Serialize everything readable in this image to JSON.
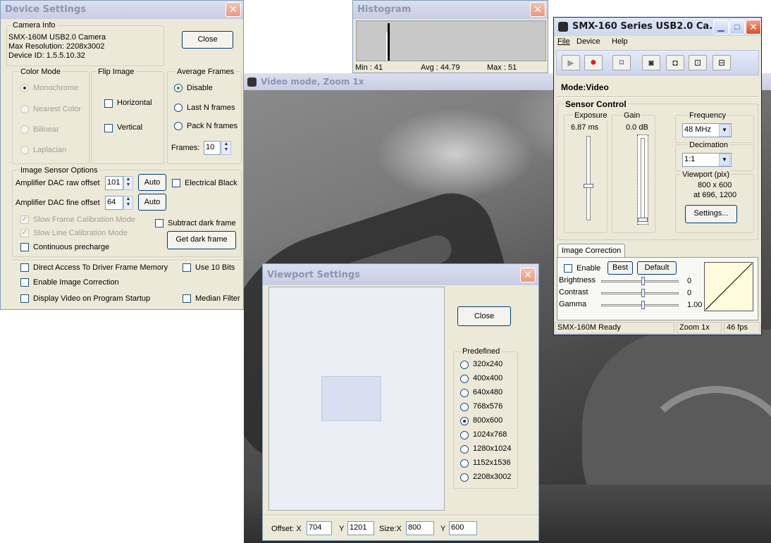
{
  "device_settings": {
    "title": "Device Settings",
    "camera_info": {
      "legend": "Camera Info",
      "model": "SMX-160M USB2.0 Camera",
      "max_resolution": "Max Resolution: 2208x3002",
      "device_id": "Device ID: 1.5.5.10.32"
    },
    "close_label": "Close",
    "color_mode": {
      "legend": "Color Mode",
      "options": [
        "Monochrome",
        "Nearest Color",
        "Bilinear",
        "Laplacian"
      ],
      "selected": "Monochrome"
    },
    "flip_image": {
      "legend": "Flip Image",
      "horizontal": "Horizontal",
      "vertical": "Vertical"
    },
    "average_frames": {
      "legend": "Average Frames",
      "options": [
        "Disable",
        "Last N frames",
        "Pack N frames"
      ],
      "selected": "Disable",
      "frames_label": "Frames:",
      "frames_value": "10"
    },
    "sensor_options": {
      "legend": "Image Sensor Options",
      "raw_offset_label": "Amplifier DAC raw offset",
      "raw_offset_value": "101",
      "fine_offset_label": "Amplifier DAC fine offset",
      "fine_offset_value": "64",
      "auto_label": "Auto",
      "electrical_black": "Electrical Black",
      "slow_frame_cal": "Slow Frame Calibration Mode",
      "slow_line_cal": "Slow Line Calibration Mode",
      "subtract_dark": "Subtract dark frame",
      "continuous_precharge": "Continuous precharge",
      "get_dark_frame": "Get dark frame"
    },
    "direct_access": "Direct Access To Driver Frame Memory",
    "use_10_bits": "Use 10 Bits",
    "enable_image_correction": "Enable Image Correction",
    "display_video_startup": "Display Video on Program Startup",
    "median_filter": "Median Filter"
  },
  "histogram": {
    "title": "Histogram",
    "min": "Min : 41",
    "avg": "Avg : 44.79",
    "max": "Max : 51",
    "peak_fraction": 0.95
  },
  "video_window": {
    "title": "Video mode, Zoom 1x"
  },
  "main_window": {
    "title": "SMX-160 Series USB2.0 Ca...",
    "menu": [
      "File",
      "Device",
      "Help"
    ],
    "toolbar_icons": [
      "play-icon",
      "record-icon",
      "fit-icon",
      "snapshot-icon",
      "snapshot-settings-icon",
      "video-capture-icon",
      "video-stop-icon"
    ],
    "mode": "Mode:Video",
    "sensor_control": "Sensor Control",
    "exposure_label": "Exposure",
    "exposure_value": "6.87 ms",
    "gain_label": "Gain",
    "gain_value": "0.0 dB",
    "frequency_label": "Frequency",
    "frequency_value": "48 MHz",
    "decimation_label": "Decimation",
    "decimation_value": "1:1",
    "viewport_label": "Viewport (pix)",
    "viewport_size": "800 x 600",
    "viewport_pos": "at 696, 1200",
    "settings_label": "Settings...",
    "image_correction_tab": "Image Correction",
    "enable_label": "Enable",
    "best_label": "Best",
    "default_label": "Default",
    "brightness_label": "Brightness",
    "brightness_value": "0",
    "contrast_label": "Contrast",
    "contrast_value": "0",
    "gamma_label": "Gamma",
    "gamma_value": "1.00",
    "status_ready": "SMX-160M Ready",
    "status_zoom": "Zoom 1x",
    "status_fps": "46 fps"
  },
  "viewport_settings": {
    "title": "Viewport Settings",
    "close_label": "Close",
    "predefined_legend": "Predefined",
    "options": [
      "320x240",
      "400x400",
      "640x480",
      "768x576",
      "800x600",
      "1024x768",
      "1280x1024",
      "1152x1536",
      "2208x3002"
    ],
    "selected": "800x600",
    "offset_label": "Offset: X",
    "offset_x": "704",
    "y_label": "Y",
    "offset_y": "1201",
    "size_label": "Size:X",
    "size_x": "800",
    "size_y": "600"
  }
}
